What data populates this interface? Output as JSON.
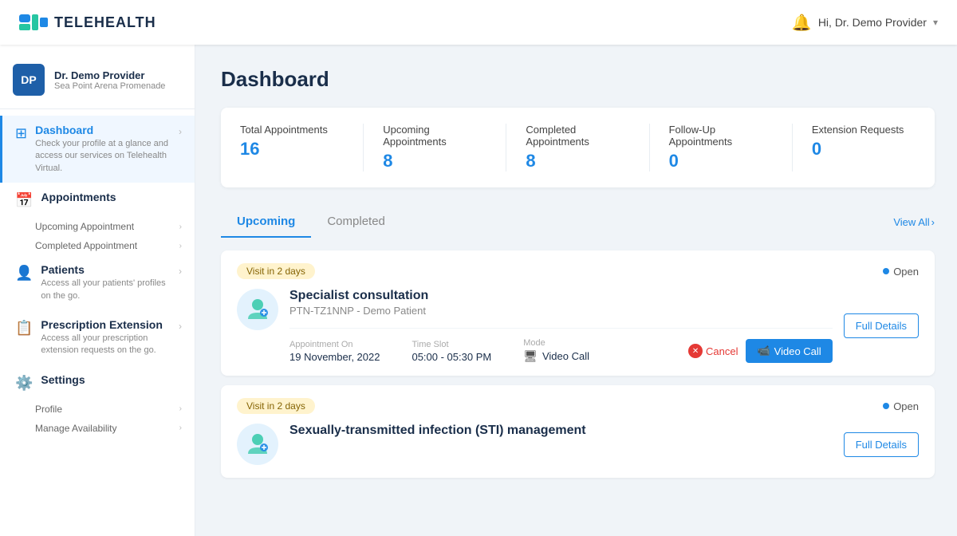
{
  "app": {
    "name": "TELEHEALTH"
  },
  "topnav": {
    "user_greeting": "Hi, Dr. Demo Provider",
    "bell_icon": "🔔"
  },
  "sidebar": {
    "profile": {
      "initials": "DP",
      "name": "Dr. Demo Provider",
      "location": "Sea Point Arena Promenade"
    },
    "items": [
      {
        "id": "dashboard",
        "icon": "⊞",
        "title": "Dashboard",
        "desc": "Check your profile at a glance and access our services on Telehealth Virtual.",
        "active": true,
        "subitems": []
      },
      {
        "id": "appointments",
        "icon": "📅",
        "title": "Appointments",
        "desc": "",
        "active": false,
        "subitems": [
          "Upcoming Appointment",
          "Completed Appointment"
        ]
      },
      {
        "id": "patients",
        "icon": "👤",
        "title": "Patients",
        "desc": "Access all your patients' profiles on the go.",
        "active": false,
        "subitems": []
      },
      {
        "id": "prescription-extension",
        "icon": "📋",
        "title": "Prescription Extension",
        "desc": "Access all your prescription extension requests on the go.",
        "active": false,
        "subitems": []
      },
      {
        "id": "settings",
        "icon": "⚙️",
        "title": "Settings",
        "desc": "",
        "active": false,
        "subitems": [
          "Profile",
          "Manage Availability"
        ]
      }
    ]
  },
  "main": {
    "page_title": "Dashboard",
    "stats": [
      {
        "label": "Total Appointments",
        "value": "16"
      },
      {
        "label": "Upcoming Appointments",
        "value": "8"
      },
      {
        "label": "Completed Appointments",
        "value": "8"
      },
      {
        "label": "Follow-Up Appointments",
        "value": "0"
      },
      {
        "label": "Extension Requests",
        "value": "0"
      }
    ],
    "tabs": [
      {
        "label": "Upcoming",
        "active": true
      },
      {
        "label": "Completed",
        "active": false
      }
    ],
    "view_all_label": "View All",
    "appointments": [
      {
        "badge": "Visit in 2 days",
        "status": "Open",
        "icon": "🩺",
        "title": "Specialist consultation",
        "patient": "PTN-TZ1NNP - Demo Patient",
        "appointment_on_label": "Appointment On",
        "appointment_on": "19 November, 2022",
        "time_slot_label": "Time Slot",
        "time_slot": "05:00 - 05:30 PM",
        "mode_label": "Mode",
        "mode": "Video Call",
        "details_btn": "Full Details",
        "cancel_label": "Cancel",
        "video_call_label": "Video Call"
      },
      {
        "badge": "Visit in 2 days",
        "status": "Open",
        "icon": "🩺",
        "title": "Sexually-transmitted infection (STI) management",
        "patient": "",
        "appointment_on_label": "",
        "appointment_on": "",
        "time_slot_label": "",
        "time_slot": "",
        "mode_label": "",
        "mode": "",
        "details_btn": "Full Details",
        "cancel_label": "",
        "video_call_label": ""
      }
    ]
  }
}
